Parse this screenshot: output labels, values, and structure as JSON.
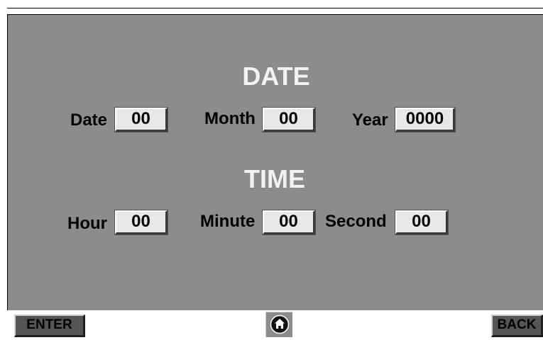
{
  "date_section": {
    "title": "DATE",
    "date_label": "Date",
    "date_value": "00",
    "month_label": "Month",
    "month_value": "00",
    "year_label": "Year",
    "year_value": "0000"
  },
  "time_section": {
    "title": "TIME",
    "hour_label": "Hour",
    "hour_value": "00",
    "minute_label": "Minute",
    "minute_value": "00",
    "second_label": "Second",
    "second_value": "00"
  },
  "buttons": {
    "enter_label": "ENTER",
    "back_label": "BACK",
    "home_icon": "home-icon"
  },
  "colors": {
    "panel_bg": "#8c8c8c",
    "heading_text": "#f2f2f2",
    "field_bg": "#e8e8e8",
    "button_face": "#555555"
  }
}
